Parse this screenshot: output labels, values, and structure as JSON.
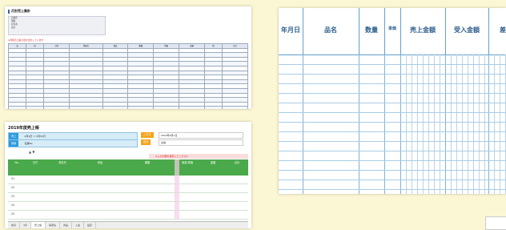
{
  "sheet": {
    "title": "月別売上集計",
    "filter_rows": [
      "店舗名",
      "期間",
      "担当者",
      "表示"
    ],
    "note": "※月別売上集計表を出力しています",
    "headers": [
      "店",
      "区",
      "日付",
      "得意先",
      "商品",
      "数量",
      "単価",
      "金額",
      "税",
      "合計"
    ],
    "row_prefix": "001"
  },
  "ledger_app": {
    "title": "2019年度売上帳",
    "row1_tag": "売上",
    "row1_field": "4月1日 ～ 3月31日",
    "row2_tag": "検索",
    "row2_field": "伝票No",
    "right_tag1": "入力日",
    "right_tag2": "担当",
    "right_field1": "2019年4月1日",
    "right_field2": "全員",
    "toolbar": "▲ ▼",
    "warning": "※入力内容を保存してください",
    "grid_headers": [
      "No.",
      "日付",
      "得意先",
      "商品",
      "摘要",
      "数量/単価",
      "金額",
      "合計"
    ],
    "row_labels": [
      "01",
      "02",
      "03",
      "04",
      "05"
    ],
    "tabs": [
      "前月",
      "4月",
      "売上帳",
      "得意先",
      "商品",
      "入金",
      "設定"
    ]
  },
  "paper": {
    "headers": [
      "年月日",
      "品名",
      "数量",
      "単価",
      "売上金額",
      "受入金額",
      "差引残高"
    ]
  }
}
